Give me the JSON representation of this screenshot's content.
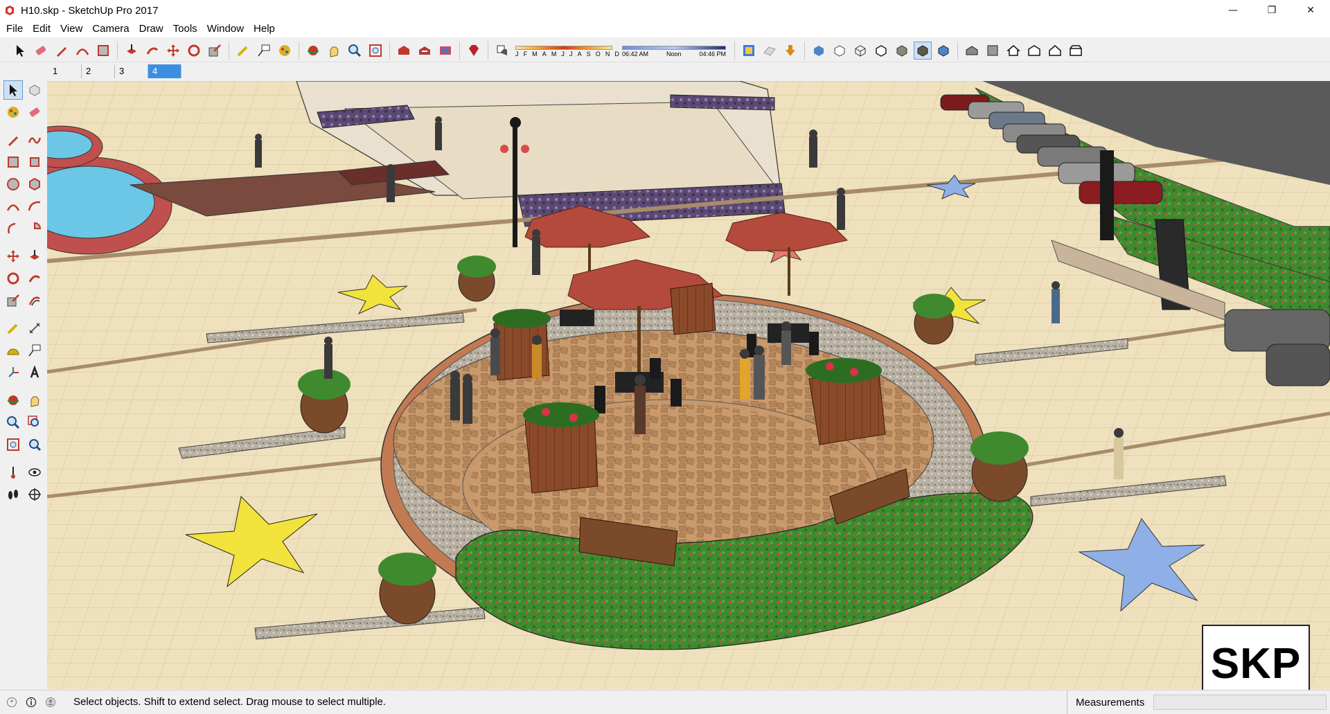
{
  "window": {
    "title": "H10.skp - SketchUp Pro 2017",
    "controls": {
      "minimize": "—",
      "maximize": "❐",
      "close": "✕"
    }
  },
  "menu": [
    "File",
    "Edit",
    "View",
    "Camera",
    "Draw",
    "Tools",
    "Window",
    "Help"
  ],
  "toolbar": {
    "groups": [
      [
        "select-icon",
        "eraser-icon",
        "pencil-icon",
        "arc-icon",
        "rectangle-icon"
      ],
      [
        "push-pull-icon",
        "follow-me-icon",
        "move-icon",
        "rotate-icon",
        "scale-icon"
      ],
      [
        "tape-measure-icon",
        "text-icon",
        "paint-bucket-icon"
      ],
      [
        "orbit-icon",
        "pan-icon",
        "zoom-icon",
        "zoom-extents-icon"
      ],
      [
        "warehouse-icon",
        "share-model-icon",
        "extension-warehouse-icon"
      ],
      [
        "ruby-icon"
      ],
      [
        "shadows-toggle-icon"
      ]
    ],
    "months": [
      "J",
      "F",
      "M",
      "A",
      "M",
      "J",
      "J",
      "A",
      "S",
      "O",
      "N",
      "D"
    ],
    "time_start": "06:42 AM",
    "time_mid": "Noon",
    "time_end": "04:46 PM",
    "right_groups": [
      [
        "model-info-icon",
        "fog-icon",
        "import-icon"
      ],
      [
        "xray-icon",
        "back-edges-icon",
        "wireframe-icon",
        "hidden-line-icon",
        "shaded-icon",
        "shaded-textures-icon",
        "monochrome-icon"
      ],
      [
        "iso-view-icon",
        "top-view-icon",
        "front-view-icon",
        "right-view-icon",
        "back-view-icon",
        "left-view-icon"
      ]
    ]
  },
  "scenes": [
    "1",
    "2",
    "3",
    "4"
  ],
  "active_scene": "4",
  "statusbar": {
    "hint": "Select objects. Shift to extend select. Drag mouse to select multiple.",
    "measurements_label": "Measurements",
    "measurements_value": ""
  },
  "badge": {
    "text": "SKP"
  },
  "colors": {
    "accent": "#3c8fe0",
    "ground": "#efe3c4",
    "lawn": "#3f8a2e",
    "umbrella": "#b34a3c",
    "star_yellow": "#f2e33c",
    "star_blue": "#8fb0e6"
  }
}
